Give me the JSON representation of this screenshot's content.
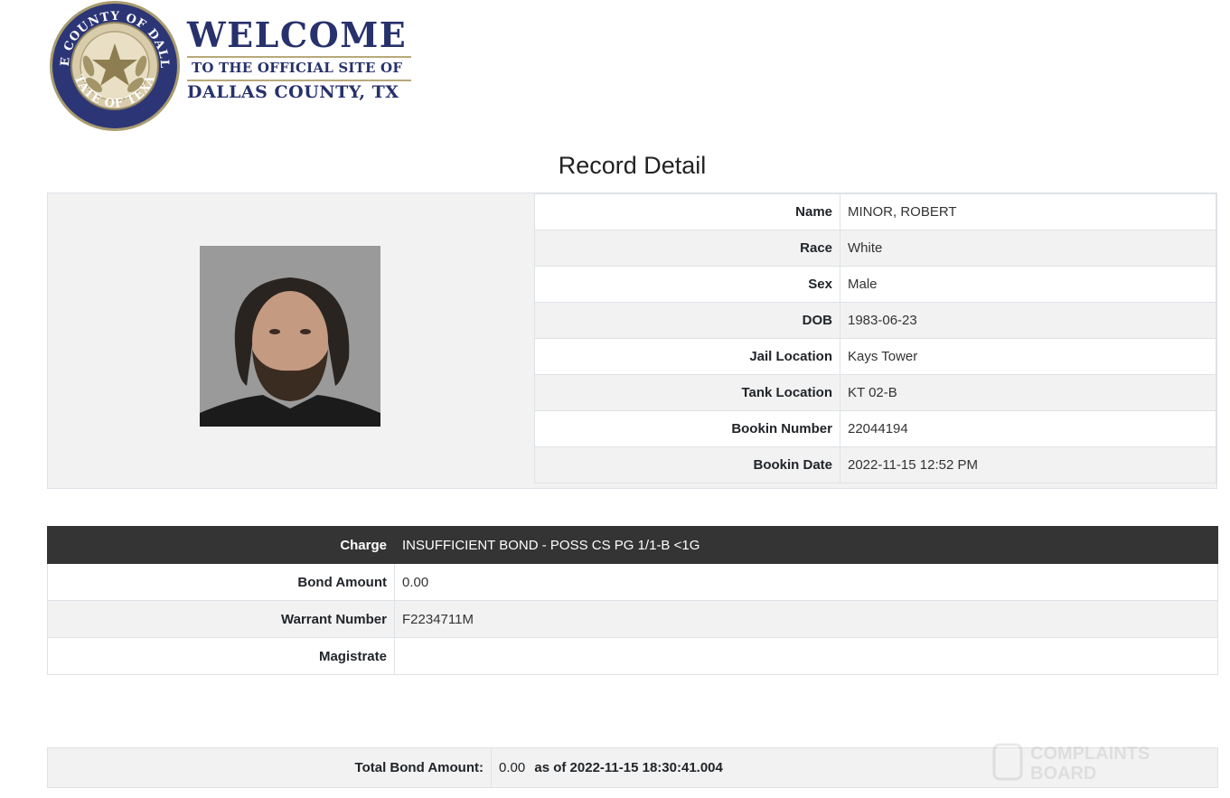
{
  "header": {
    "seal_top_text": "THE COUNTY OF DALLAS",
    "seal_bottom_text": "STATE OF TEXAS",
    "welcome": "WELCOME",
    "subtitle": "TO THE OFFICIAL SITE OF",
    "county": "DALLAS COUNTY, TX",
    "colors": {
      "navy": "#27316b",
      "gold": "#b8a97a"
    }
  },
  "page_title": "Record Detail",
  "photo": {
    "description_icon": "mugshot-photo"
  },
  "details": [
    {
      "label": "Name",
      "value": "MINOR, ROBERT"
    },
    {
      "label": "Race",
      "value": "White"
    },
    {
      "label": "Sex",
      "value": "Male"
    },
    {
      "label": "DOB",
      "value": "1983-06-23"
    },
    {
      "label": "Jail Location",
      "value": "Kays Tower"
    },
    {
      "label": "Tank Location",
      "value": "KT 02-B"
    },
    {
      "label": "Bookin Number",
      "value": "22044194"
    },
    {
      "label": "Bookin Date",
      "value": "2022-11-15 12:52 PM"
    }
  ],
  "charge": {
    "charge_label": "Charge",
    "charge_value": "INSUFFICIENT BOND - POSS CS PG 1/1-B <1G",
    "bond_label": "Bond Amount",
    "bond_value": "0.00",
    "warrant_label": "Warrant Number",
    "warrant_value": "F2234711M",
    "magistrate_label": "Magistrate",
    "magistrate_value": ""
  },
  "total": {
    "label": "Total Bond Amount:",
    "value": "0.00",
    "as_of": "as of 2022-11-15 18:30:41.004"
  },
  "watermark": {
    "line1": "COMPLAINTS",
    "line2": "BOARD"
  }
}
